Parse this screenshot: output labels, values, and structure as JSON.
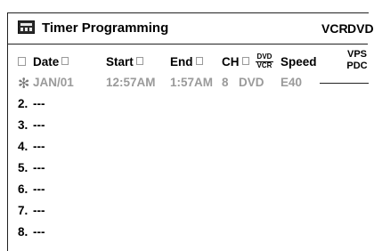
{
  "header": {
    "title": "Timer Programming",
    "mode_vcr": "VCR",
    "mode_dvd": "DVD",
    "icon": "timer-menu-icon"
  },
  "columns": {
    "date": "Date",
    "start": "Start",
    "end": "End",
    "ch": "CH",
    "media_top": "DVD",
    "media_bottom": "VCR",
    "speed": "Speed",
    "vps": "VPS",
    "pdc": "PDC"
  },
  "program": {
    "marker": "✻",
    "date": "JAN/01",
    "start": "12:57AM",
    "end": "1:57AM",
    "ch": "8",
    "media": "DVD",
    "speed": "E40"
  },
  "slots": [
    {
      "num": "2.",
      "value": "---"
    },
    {
      "num": "3.",
      "value": "---"
    },
    {
      "num": "4.",
      "value": "---"
    },
    {
      "num": "5.",
      "value": "---"
    },
    {
      "num": "6.",
      "value": "---"
    },
    {
      "num": "7.",
      "value": "---"
    },
    {
      "num": "8.",
      "value": "---"
    }
  ]
}
